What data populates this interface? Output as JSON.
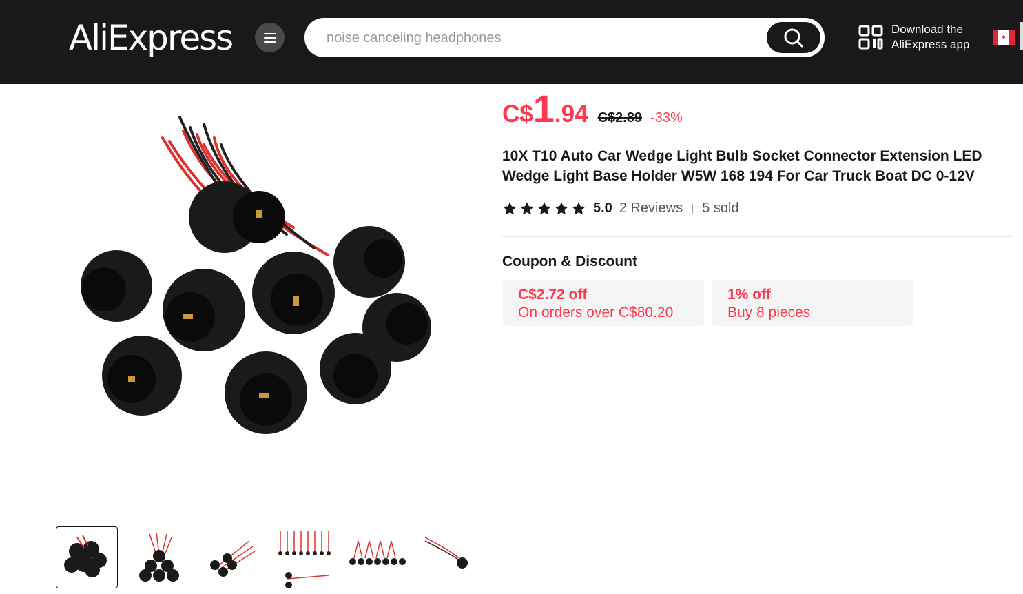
{
  "header": {
    "logo": "AliExpress",
    "search_placeholder": "noise canceling headphones",
    "download_line1": "Download the",
    "download_line2": "AliExpress app",
    "country_flag": "canada-flag-icon"
  },
  "product": {
    "price_currency": "C$",
    "price_integer": "1",
    "price_decimal": ".94",
    "price_original": "C$2.89",
    "discount": "-33%",
    "title": "10X T10 Auto Car Wedge Light Bulb Socket Connector Extension LED Wedge Light Base Holder W5W 168 194 For Car Truck Boat DC 0-12V",
    "rating_score": "5.0",
    "reviews": "2 Reviews",
    "sold": "5 sold",
    "stars": 5
  },
  "coupons": {
    "section_title": "Coupon & Discount",
    "items": [
      {
        "headline": "C$2.72 off",
        "detail": "On orders over C$80.20"
      },
      {
        "headline": "1% off",
        "detail": "Buy 8 pieces"
      }
    ]
  },
  "gallery": {
    "thumbnail_count": 6,
    "active_index": 0
  },
  "colors": {
    "accent": "#fd384f",
    "header_bg": "#191919"
  }
}
